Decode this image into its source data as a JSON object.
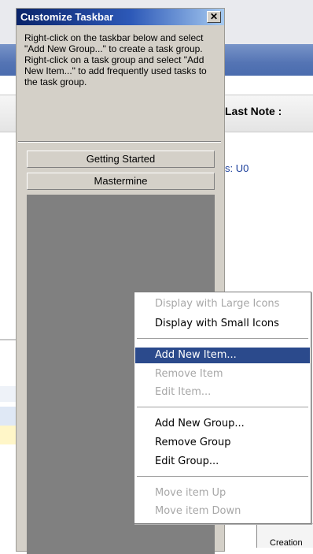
{
  "window": {
    "title": "Customize Taskbar",
    "close_glyph": "✕",
    "instructions": "Right-click on the taskbar below and select \"Add New Group...\" to create a task group. Right-click on a task group and select \"Add New Item...\" to add frequently used tasks to the task group."
  },
  "groups": [
    "Getting Started",
    "Mastermine"
  ],
  "background": {
    "last_note_header": "Last Note :",
    "uo_text": "s: U0",
    "creation_text": "Creation"
  },
  "context_menu": {
    "items": [
      {
        "label": "Display with Large Icons",
        "enabled": false
      },
      {
        "label": "Display with Small Icons",
        "enabled": true
      },
      {
        "label": "Add New Item...",
        "enabled": true,
        "highlighted": true
      },
      {
        "label": "Remove Item",
        "enabled": false
      },
      {
        "label": "Edit Item...",
        "enabled": false
      },
      {
        "label": "Add New Group...",
        "enabled": true
      },
      {
        "label": "Remove Group",
        "enabled": true
      },
      {
        "label": "Edit Group...",
        "enabled": true
      },
      {
        "label": "Move item Up",
        "enabled": false
      },
      {
        "label": "Move item Down",
        "enabled": false
      }
    ]
  },
  "colors": {
    "titlebar_start": "#0a246a",
    "titlebar_end": "#a6caf0",
    "menu_highlight": "#2b4a8c",
    "dialog_face": "#d4d0c8",
    "group_area": "#808080"
  }
}
